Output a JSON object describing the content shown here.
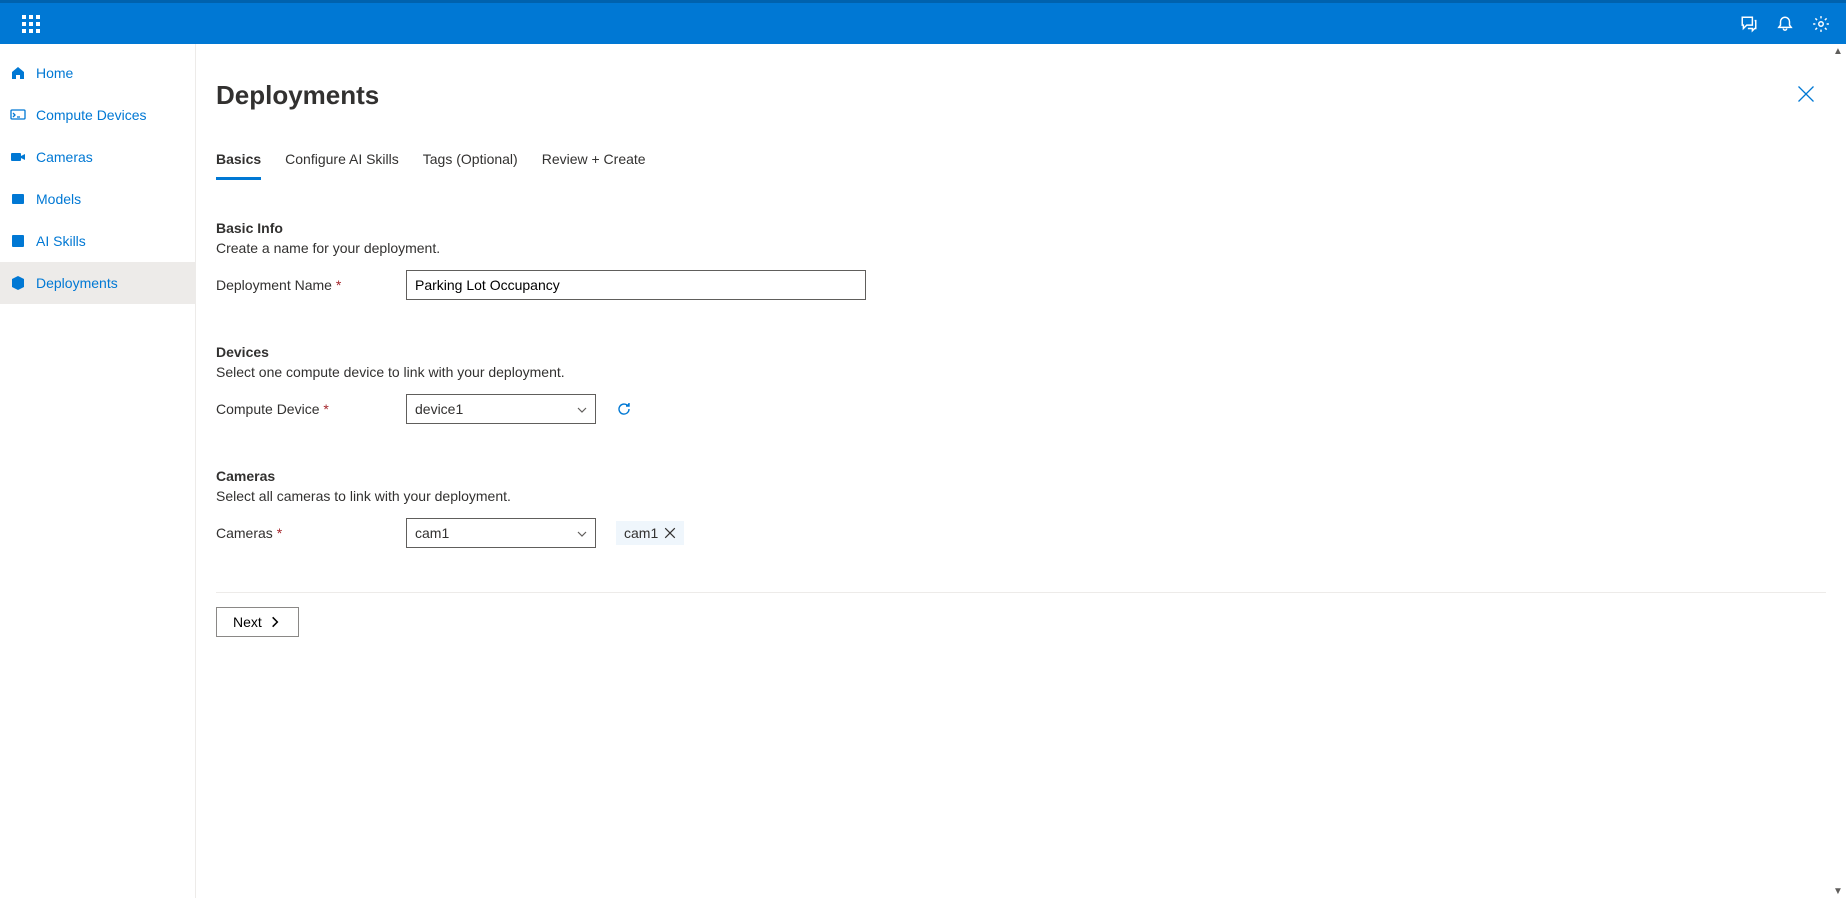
{
  "sidebar": {
    "items": [
      {
        "label": "Home"
      },
      {
        "label": "Compute Devices"
      },
      {
        "label": "Cameras"
      },
      {
        "label": "Models"
      },
      {
        "label": "AI Skills"
      },
      {
        "label": "Deployments"
      }
    ]
  },
  "page": {
    "title": "Deployments"
  },
  "tabs": [
    {
      "label": "Basics"
    },
    {
      "label": "Configure AI Skills"
    },
    {
      "label": "Tags (Optional)"
    },
    {
      "label": "Review + Create"
    }
  ],
  "sections": {
    "basic": {
      "heading": "Basic Info",
      "desc": "Create a name for your deployment.",
      "nameLabel": "Deployment Name",
      "nameValue": "Parking Lot Occupancy"
    },
    "devices": {
      "heading": "Devices",
      "desc": "Select one compute device to link with your deployment.",
      "label": "Compute Device",
      "value": "device1"
    },
    "cameras": {
      "heading": "Cameras",
      "desc": "Select all cameras to link with your deployment.",
      "label": "Cameras",
      "value": "cam1",
      "chip": "cam1"
    }
  },
  "footer": {
    "next": "Next"
  }
}
